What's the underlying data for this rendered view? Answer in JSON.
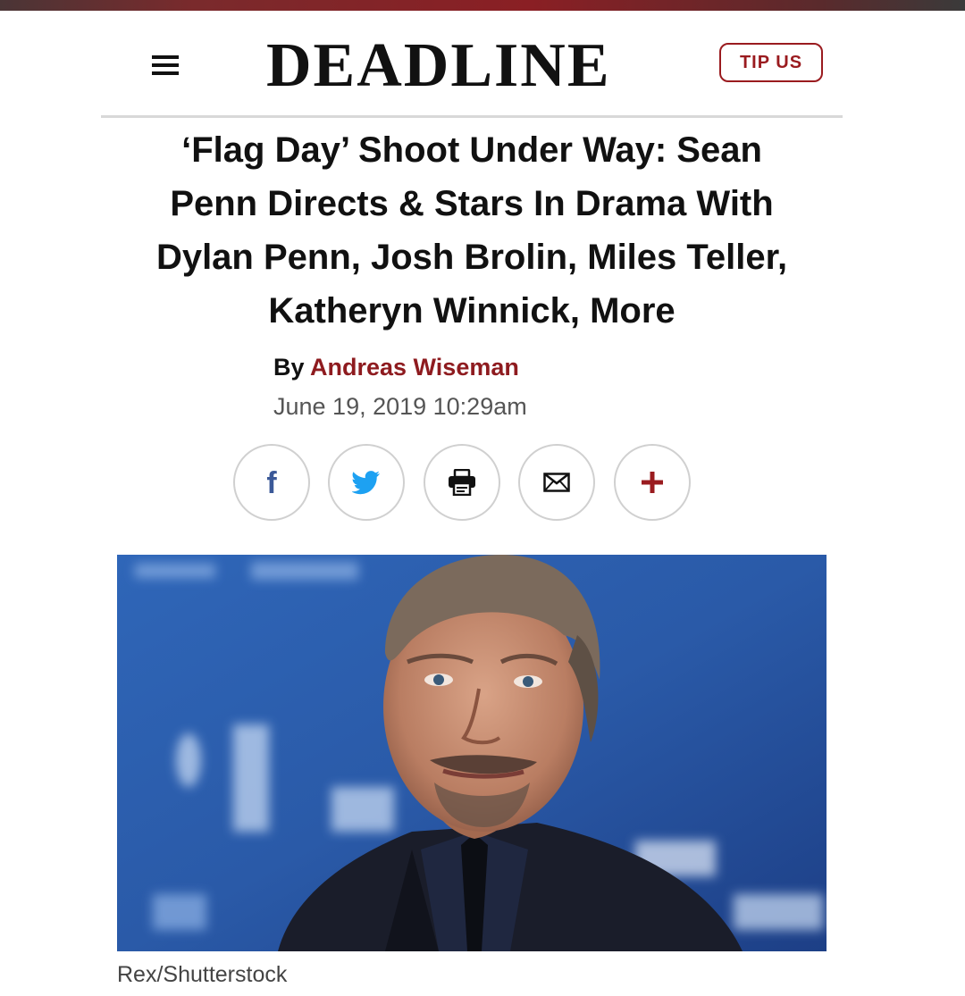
{
  "header": {
    "logo_text": "DEADLINE",
    "menu_icon": "hamburger-menu-icon",
    "tip_button_label": "TIP US"
  },
  "article": {
    "headline_lines": [
      "‘Flag Day’ Shoot Under Way: Sean",
      "Penn Directs & Stars In Drama With",
      "Dylan Penn, Josh Brolin, Miles Teller,",
      "Katheryn Winnick, More"
    ],
    "byline_prefix": "By",
    "author": "Andreas Wiseman",
    "date": "June 19, 2019 10:29am",
    "share_buttons": [
      {
        "name": "facebook",
        "icon": "facebook-icon",
        "color": "#3b5998"
      },
      {
        "name": "twitter",
        "icon": "twitter-icon",
        "color": "#1da1f2"
      },
      {
        "name": "print",
        "icon": "printer-icon",
        "color": "#111111"
      },
      {
        "name": "email",
        "icon": "mail-icon",
        "color": "#111111"
      },
      {
        "name": "more",
        "icon": "plus-icon",
        "color": "#9a1b1f"
      }
    ],
    "photo_caption": "Rex/Shutterstock"
  },
  "colors": {
    "brand_red": "#9a1b1f",
    "author_link": "#8e1b1f",
    "divider": "#d8d8d8"
  }
}
